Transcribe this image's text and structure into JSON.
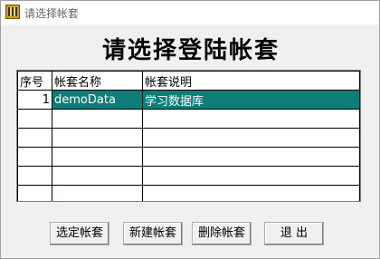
{
  "window": {
    "title": "请选择帐套",
    "heading": "请选择登陆帐套"
  },
  "table": {
    "columns": [
      "序号",
      "帐套名称",
      "帐套说明"
    ],
    "rows": [
      {
        "index": "1",
        "name": "demoData",
        "description": "学习数据库",
        "selected": true
      },
      {
        "index": "",
        "name": "",
        "description": ""
      },
      {
        "index": "",
        "name": "",
        "description": ""
      },
      {
        "index": "",
        "name": "",
        "description": ""
      },
      {
        "index": "",
        "name": "",
        "description": ""
      },
      {
        "index": "",
        "name": "",
        "description": ""
      }
    ],
    "selected_color": "#0f7d78"
  },
  "buttons": {
    "select": "选定帐套",
    "new": "新建帐套",
    "delete": "删除帐套",
    "exit": "退 出"
  }
}
